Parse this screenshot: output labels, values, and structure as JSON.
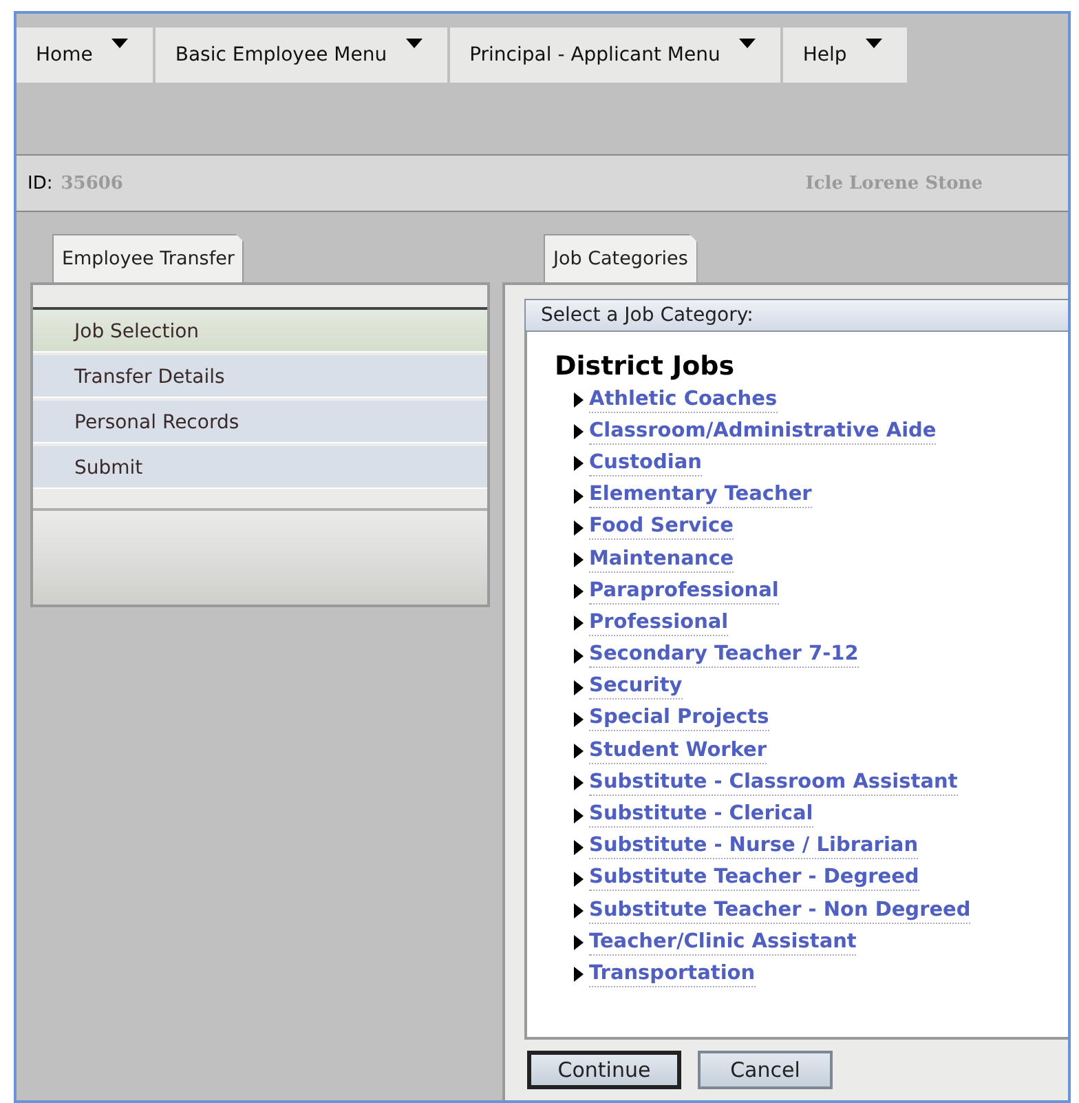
{
  "menu_bar": [
    {
      "label": "Home"
    },
    {
      "label": "Basic Employee Menu"
    },
    {
      "label": "Principal - Applicant Menu"
    },
    {
      "label": "Help"
    }
  ],
  "id_bar": {
    "label": "ID:",
    "value": "35606",
    "name": "Icle Lorene Stone"
  },
  "left_panel": {
    "tab": "Employee Transfer",
    "steps": [
      {
        "label": "Job Selection",
        "selected": true
      },
      {
        "label": "Transfer Details",
        "selected": false
      },
      {
        "label": "Personal Records",
        "selected": false
      },
      {
        "label": "Submit",
        "selected": false
      }
    ]
  },
  "right_panel": {
    "tab": "Job Categories",
    "header": "Select a Job Category:",
    "group_title": "District Jobs",
    "categories": [
      "Athletic Coaches",
      "Classroom/Administrative Aide",
      "Custodian",
      "Elementary Teacher",
      "Food Service",
      "Maintenance",
      "Paraprofessional",
      "Professional",
      "Secondary Teacher 7-12",
      "Security",
      "Special Projects",
      "Student Worker",
      "Substitute - Classroom Assistant",
      "Substitute - Clerical",
      "Substitute - Nurse / Librarian",
      "Substitute Teacher - Degreed",
      "Substitute Teacher - Non Degreed",
      "Teacher/Clinic Assistant",
      "Transportation"
    ],
    "buttons": [
      {
        "label": "Continue",
        "default": true
      },
      {
        "label": "Cancel",
        "default": false
      }
    ]
  }
}
